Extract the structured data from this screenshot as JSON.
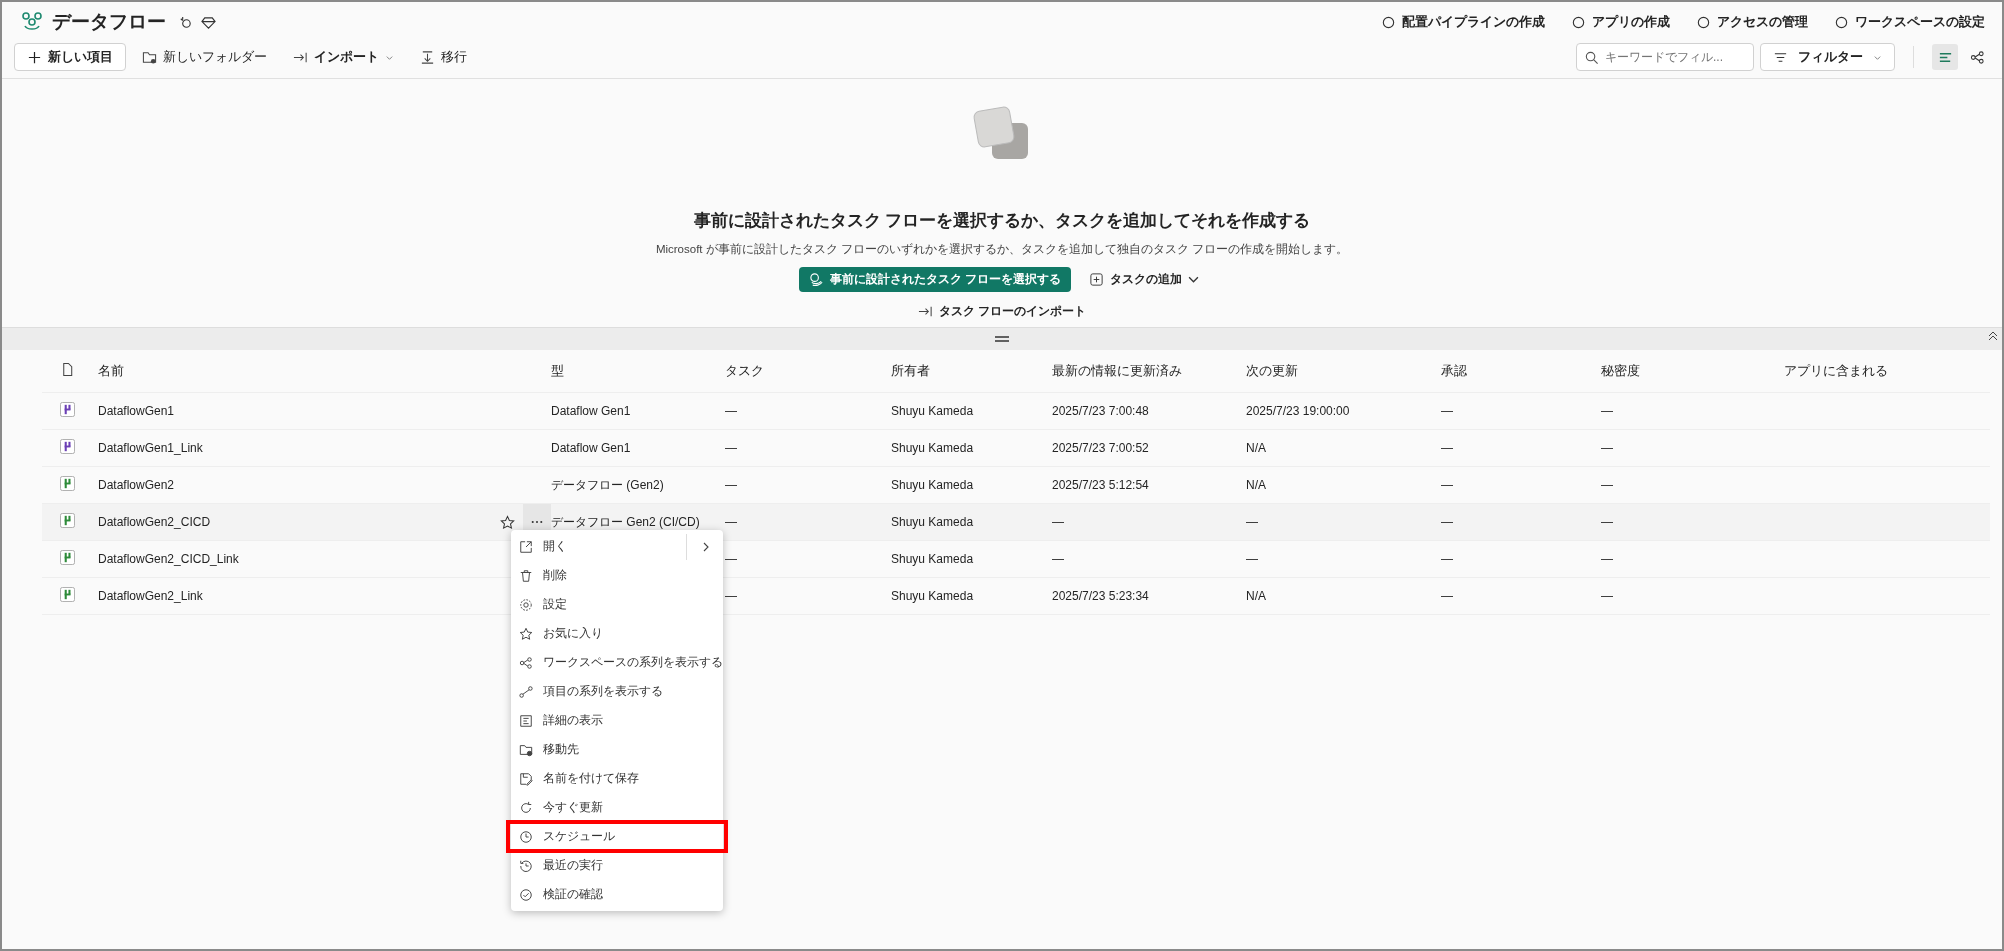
{
  "header": {
    "title": "データフロー",
    "actions": [
      "配置パイプラインの作成",
      "アプリの作成",
      "アクセスの管理",
      "ワークスペースの設定"
    ]
  },
  "toolbar": {
    "items": [
      {
        "kind": "primary",
        "label": "新しい項目"
      },
      {
        "kind": "folder",
        "label": "新しいフォルダー"
      },
      {
        "kind": "import",
        "label": "インポート"
      },
      {
        "kind": "migrate",
        "label": "移行"
      }
    ],
    "search": {
      "placeholder": "キーワードでフィル..."
    },
    "filter": "フィルター"
  },
  "hero": {
    "heading": "事前に設計されたタスク フローを選択するか、タスクを追加してそれを作成する",
    "text": "Microsoft が事前に設計したタスク フローのいずれかを選択するか、タスクを追加して独自のタスク フローの作成を開始します。",
    "primary_button": "事前に設計されたタスク フローを選択する",
    "add_button": "タスクの追加",
    "import_link": "タスク フローのインポート"
  },
  "table": {
    "columns": [
      "名前",
      "型",
      "タスク",
      "所有者",
      "最新の情報に更新済み",
      "次の更新",
      "承認",
      "秘密度",
      "アプリに含まれる"
    ],
    "rows": [
      {
        "color": "#6b3fb5",
        "name": "DataflowGen1",
        "type": "Dataflow Gen1",
        "task": "—",
        "owner": "Shuyu Kameda",
        "refreshed": "2025/7/23 7:00:48",
        "next": "2025/7/23 19:00:00",
        "approval": "—",
        "sensitivity": "—",
        "hovered": false
      },
      {
        "color": "#6b3fb5",
        "name": "DataflowGen1_Link",
        "type": "Dataflow Gen1",
        "task": "—",
        "owner": "Shuyu Kameda",
        "refreshed": "2025/7/23 7:00:52",
        "next": "N/A",
        "approval": "—",
        "sensitivity": "—",
        "hovered": false
      },
      {
        "color": "#2e8b3a",
        "name": "DataflowGen2",
        "type": "データフロー (Gen2)",
        "task": "—",
        "owner": "Shuyu Kameda",
        "refreshed": "2025/7/23 5:12:54",
        "next": "N/A",
        "approval": "—",
        "sensitivity": "—",
        "hovered": false
      },
      {
        "color": "#2e8b3a",
        "name": "DataflowGen2_CICD",
        "type": "データフロー Gen2 (CI/CD)",
        "task": "—",
        "owner": "Shuyu Kameda",
        "refreshed": "—",
        "next": "—",
        "approval": "—",
        "sensitivity": "—",
        "hovered": true
      },
      {
        "color": "#2e8b3a",
        "name": "DataflowGen2_CICD_Link",
        "task": "—",
        "owner": "Shuyu Kameda",
        "refreshed": "—",
        "next": "—",
        "approval": "—",
        "sensitivity": "—",
        "hovered": false
      },
      {
        "color": "#2e8b3a",
        "name": "DataflowGen2_Link",
        "task": "—",
        "owner": "Shuyu Kameda",
        "refreshed": "2025/7/23 5:23:34",
        "next": "N/A",
        "approval": "—",
        "sensitivity": "—",
        "hovered": false
      }
    ]
  },
  "context_menu": {
    "items": [
      {
        "label": "開く",
        "submenu": true,
        "highlighted": false
      },
      {
        "label": "削除",
        "highlighted": false
      },
      {
        "label": "設定",
        "highlighted": false
      },
      {
        "label": "お気に入り",
        "highlighted": false
      },
      {
        "label": "ワークスペースの系列を表示する",
        "highlighted": false
      },
      {
        "label": "項目の系列を表示する",
        "highlighted": false
      },
      {
        "label": "詳細の表示",
        "highlighted": false
      },
      {
        "label": "移動先",
        "highlighted": false
      },
      {
        "label": "名前を付けて保存",
        "highlighted": false
      },
      {
        "label": "今すぐ更新",
        "highlighted": false
      },
      {
        "label": "スケジュール",
        "highlighted": true
      },
      {
        "label": "最近の実行",
        "highlighted": false
      },
      {
        "label": "検証の確認",
        "highlighted": false
      }
    ]
  }
}
